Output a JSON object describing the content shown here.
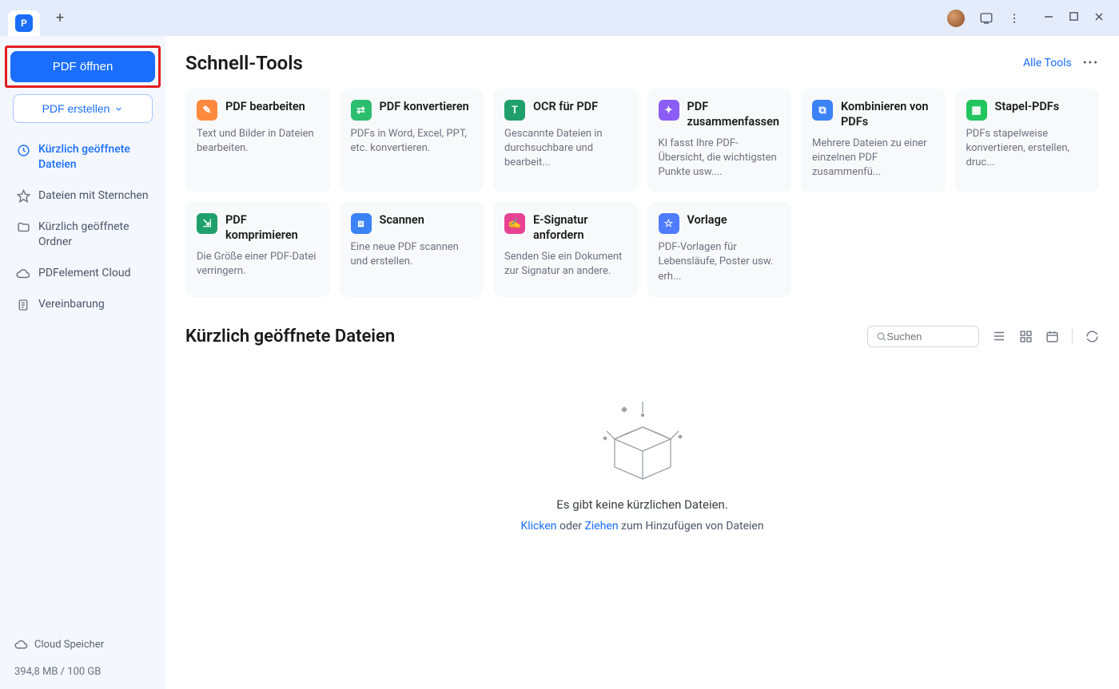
{
  "titlebar": {
    "app_initial": "P"
  },
  "sidebar": {
    "open_pdf": "PDF öffnen",
    "create_pdf": "PDF erstellen",
    "nav": [
      {
        "label": "Kürzlich geöffnete Dateien"
      },
      {
        "label": "Dateien mit Sternchen"
      },
      {
        "label": "Kürzlich geöffnete Ordner"
      },
      {
        "label": "PDFelement Cloud"
      },
      {
        "label": "Vereinbarung"
      }
    ],
    "cloud_label": "Cloud Speicher",
    "storage": "394,8 MB / 100 GB"
  },
  "main": {
    "quick_tools_title": "Schnell-Tools",
    "all_tools": "Alle Tools",
    "tools": [
      {
        "title": "PDF bearbeiten",
        "desc": "Text und Bilder in Dateien bearbeiten."
      },
      {
        "title": "PDF konvertieren",
        "desc": "PDFs in Word, Excel, PPT, etc. konvertieren."
      },
      {
        "title": "OCR für PDF",
        "desc": "Gescannte Dateien in durchsuchbare und bearbeit..."
      },
      {
        "title": "PDF zusammenfassen",
        "desc": "KI fasst Ihre PDF-Übersicht, die wichtigsten Punkte usw...."
      },
      {
        "title": "Kombinieren von PDFs",
        "desc": "Mehrere Dateien zu einer einzelnen PDF zusammenfü..."
      },
      {
        "title": "Stapel-PDFs",
        "desc": "PDFs stapelweise konvertieren, erstellen, druc..."
      },
      {
        "title": "PDF komprimieren",
        "desc": "Die Größe einer PDF-Datei verringern."
      },
      {
        "title": "Scannen",
        "desc": "Eine neue PDF scannen und erstellen."
      },
      {
        "title": "E-Signatur anfordern",
        "desc": "Senden Sie ein Dokument zur Signatur an andere."
      },
      {
        "title": "Vorlage",
        "desc": "PDF-Vorlagen für Lebensläufe, Poster usw. erh..."
      }
    ],
    "recent_title": "Kürzlich geöffnete Dateien",
    "search_placeholder": "Suchen",
    "empty_main": "Es gibt keine kürzlichen Dateien.",
    "empty_click": "Klicken",
    "empty_or": " oder ",
    "empty_drag": "Ziehen",
    "empty_tail": " zum Hinzufügen von Dateien"
  }
}
